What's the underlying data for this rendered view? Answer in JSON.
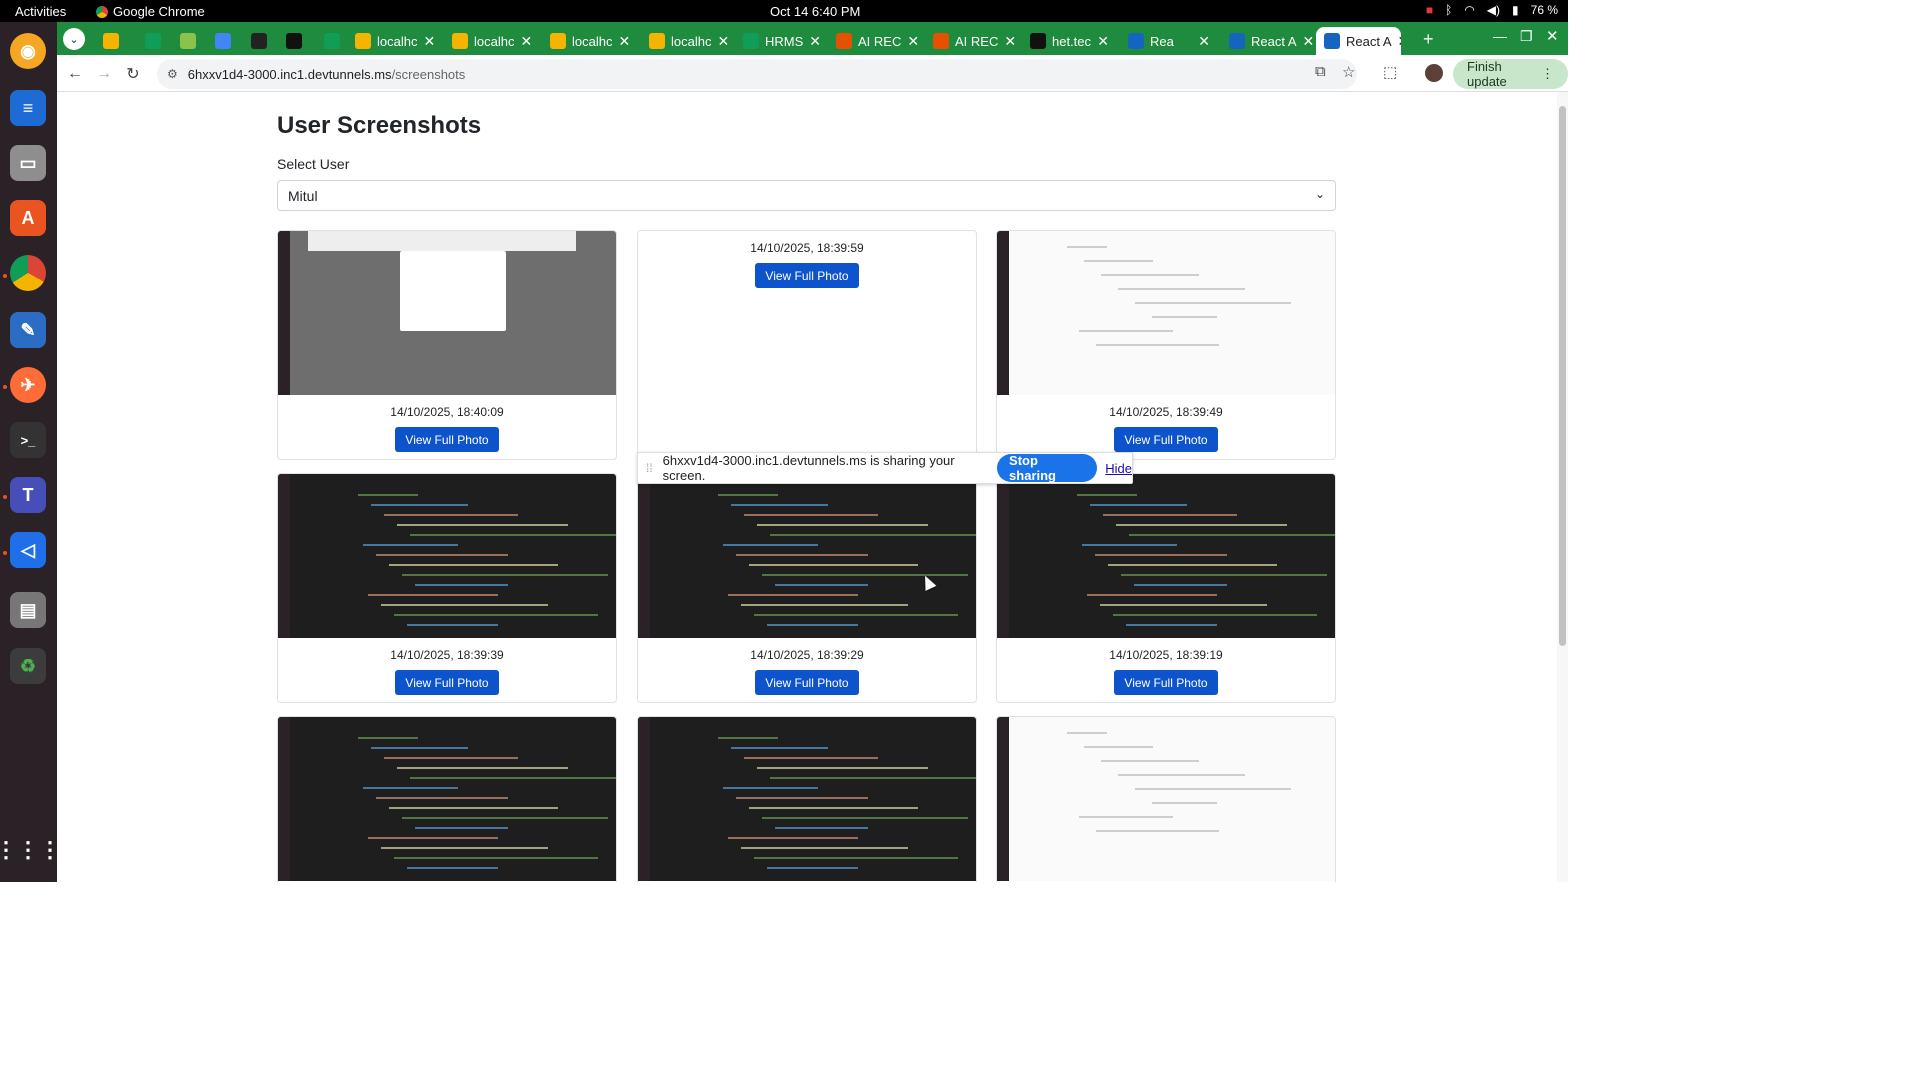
{
  "topbar": {
    "activities": "Activities",
    "app_name": "Google Chrome",
    "clock": "Oct 14  6:40 PM",
    "battery": "76 %"
  },
  "tabs": [
    {
      "label": "",
      "fav": "#f5b400"
    },
    {
      "label": "",
      "fav": "#0f9d58"
    },
    {
      "label": "",
      "fav": "#8bc34a"
    },
    {
      "label": "",
      "fav": "#4285f4"
    },
    {
      "label": "",
      "fav": "#222222"
    },
    {
      "label": "",
      "fav": "#111111"
    },
    {
      "label": "",
      "fav": "#0f9d58"
    },
    {
      "label": "localhc",
      "fav": "#f5b400"
    },
    {
      "label": "localhc",
      "fav": "#f5b400"
    },
    {
      "label": "localhc",
      "fav": "#f5b400"
    },
    {
      "label": "localhc",
      "fav": "#f5b400"
    },
    {
      "label": "HRMS",
      "fav": "#0f9d58"
    },
    {
      "label": "AI REC",
      "fav": "#e65100"
    },
    {
      "label": "AI REC",
      "fav": "#e65100"
    },
    {
      "label": "het.tec",
      "fav": "#111111"
    },
    {
      "label": "Rea",
      "fav": "#1565c0"
    },
    {
      "label": "React A",
      "fav": "#1565c0"
    },
    {
      "label": "React A",
      "fav": "#1565c0"
    }
  ],
  "toolbar": {
    "url_host": "6hxxv1d4-3000.inc1.devtunnels.ms",
    "url_path": "/screenshots",
    "finish_update": "Finish update"
  },
  "page": {
    "title": "User Screenshots",
    "select_label": "Select User",
    "selected_user": "Mitul"
  },
  "cards": [
    {
      "timestamp": "14/10/2025, 18:40:09",
      "button": "View Full Photo",
      "thumb": "grey"
    },
    {
      "timestamp": "14/10/2025, 18:39:59",
      "button": "View Full Photo",
      "thumb": "none"
    },
    {
      "timestamp": "14/10/2025, 18:39:49",
      "button": "View Full Photo",
      "thumb": "light"
    },
    {
      "timestamp": "14/10/2025, 18:39:39",
      "button": "View Full Photo",
      "thumb": "dark"
    },
    {
      "timestamp": "14/10/2025, 18:39:29",
      "button": "View Full Photo",
      "thumb": "dark"
    },
    {
      "timestamp": "14/10/2025, 18:39:19",
      "button": "View Full Photo",
      "thumb": "dark"
    },
    {
      "timestamp": "",
      "button": "",
      "thumb": "dark"
    },
    {
      "timestamp": "",
      "button": "",
      "thumb": "dark"
    },
    {
      "timestamp": "",
      "button": "",
      "thumb": "light"
    }
  ],
  "share_bar": {
    "message": "6hxxv1d4-3000.inc1.devtunnels.ms is sharing your screen.",
    "stop": "Stop sharing",
    "hide": "Hide"
  },
  "dock_icons": [
    "rhythmbox-icon",
    "writer-icon",
    "files-icon",
    "app-center-icon",
    "chrome-icon",
    "text-editor-icon",
    "postman-icon",
    "terminal-icon",
    "teams-icon",
    "vscode-icon",
    "archive-icon",
    "trash-icon",
    "app-grid-icon"
  ]
}
